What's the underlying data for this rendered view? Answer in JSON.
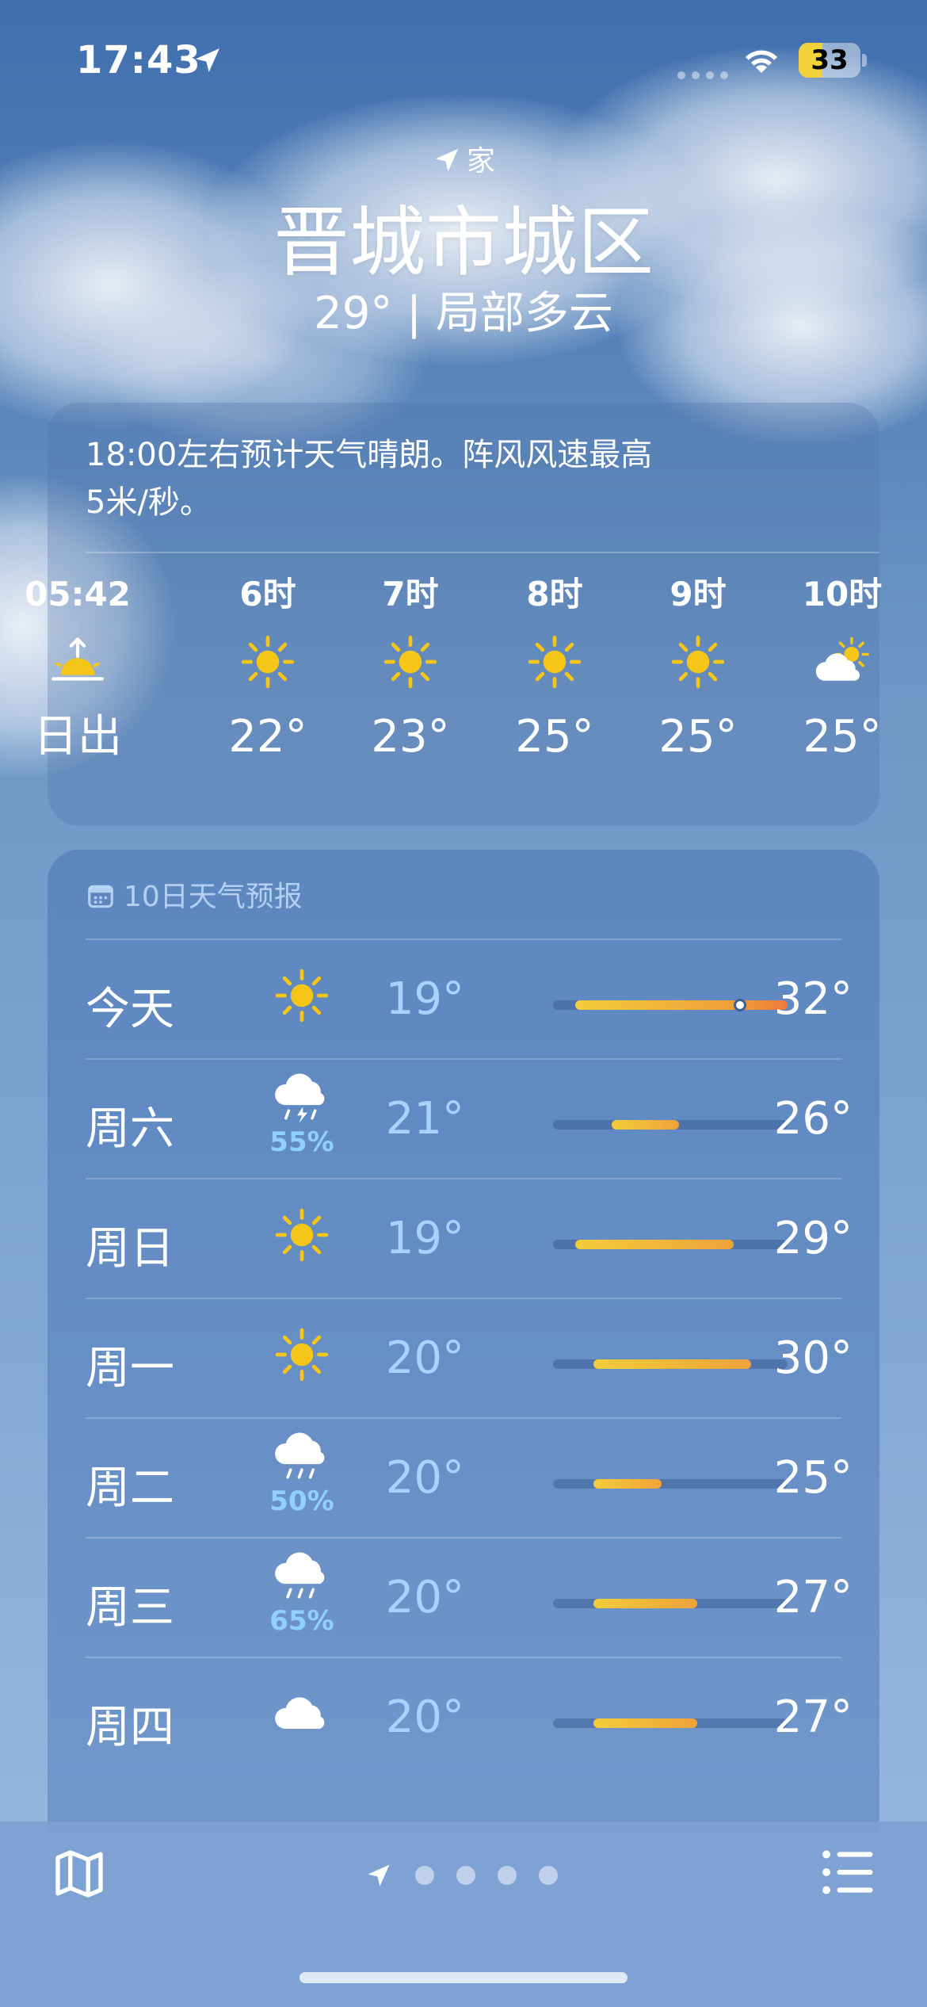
{
  "status_bar": {
    "time": "17:43",
    "battery": "33"
  },
  "location": {
    "tag": "家",
    "city": "晋城市城区",
    "current": "29° | 局部多云"
  },
  "hourly": {
    "summary": "18:00左右预计天气晴朗。阵风风速最高\n5米/秒。",
    "items": [
      {
        "label": "05:42",
        "icon": "sunrise-icon",
        "value": "日出"
      },
      {
        "label": "6时",
        "icon": "sun-icon",
        "value": "22°"
      },
      {
        "label": "7时",
        "icon": "sun-icon",
        "value": "23°"
      },
      {
        "label": "8时",
        "icon": "sun-icon",
        "value": "25°"
      },
      {
        "label": "9时",
        "icon": "sun-icon",
        "value": "25°"
      },
      {
        "label": "10时",
        "icon": "partly-cloudy-icon",
        "value": "25°"
      }
    ]
  },
  "daily": {
    "title": "10日天气预报",
    "range": [
      19,
      32
    ],
    "days": [
      {
        "day": "今天",
        "icon": "sun-icon",
        "precip": "",
        "low": "19°",
        "high": "32°",
        "lo_val": 19,
        "hi_val": 32,
        "current": 29
      },
      {
        "day": "周六",
        "icon": "thunderstorm-icon",
        "precip": "55%",
        "low": "21°",
        "high": "26°",
        "lo_val": 21,
        "hi_val": 26
      },
      {
        "day": "周日",
        "icon": "sun-icon",
        "precip": "",
        "low": "19°",
        "high": "29°",
        "lo_val": 19,
        "hi_val": 29
      },
      {
        "day": "周一",
        "icon": "sun-icon",
        "precip": "",
        "low": "20°",
        "high": "30°",
        "lo_val": 20,
        "hi_val": 30
      },
      {
        "day": "周二",
        "icon": "rain-icon",
        "precip": "50%",
        "low": "20°",
        "high": "25°",
        "lo_val": 20,
        "hi_val": 25
      },
      {
        "day": "周三",
        "icon": "rain-icon",
        "precip": "65%",
        "low": "20°",
        "high": "27°",
        "lo_val": 20,
        "hi_val": 27
      },
      {
        "day": "周四",
        "icon": "cloud-icon",
        "precip": "",
        "low": "20°",
        "high": "27°",
        "lo_val": 20,
        "hi_val": 27
      }
    ]
  },
  "colors": {
    "accent_sun": "#f5c518",
    "bar_warm": "#f0a23a",
    "precip": "#8fd0ff"
  }
}
